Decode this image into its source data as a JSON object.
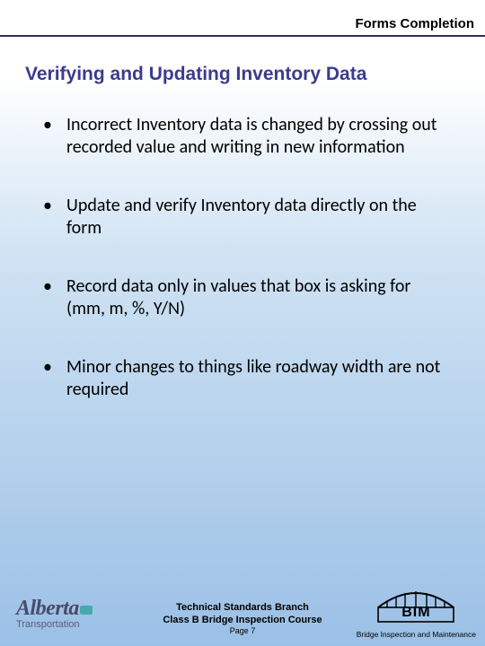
{
  "header": {
    "section": "Forms Completion"
  },
  "title": "Verifying and Updating Inventory Data",
  "bullets": [
    "Incorrect Inventory data is changed by crossing out recorded value and writing in new information",
    "Update and verify Inventory data directly on the form",
    "Record data only in values that box is asking for (mm, m, %, Y/N)",
    "Minor changes to things like roadway width are not required"
  ],
  "footer": {
    "logo_brand": "Alberta",
    "logo_dept": "Transportation",
    "center_line1": "Technical Standards Branch",
    "center_line2": "Class B Bridge Inspection Course",
    "page": "Page 7",
    "bim_label": "BIM",
    "bim_caption": "Bridge Inspection and Maintenance"
  }
}
